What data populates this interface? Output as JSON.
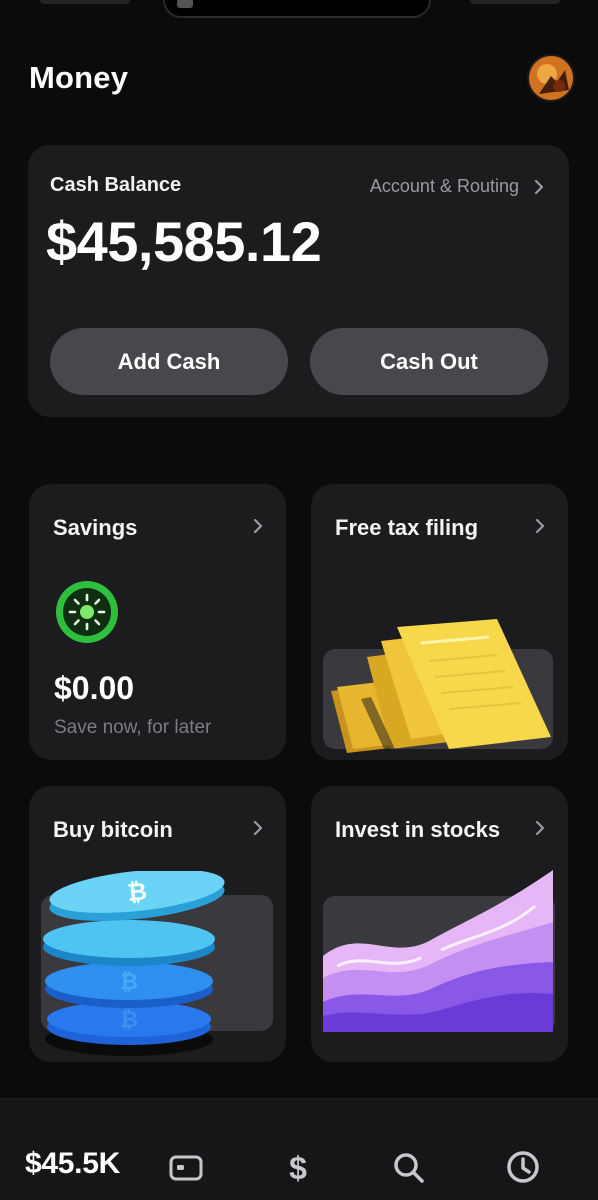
{
  "header": {
    "title": "Money"
  },
  "balance_card": {
    "label": "Cash Balance",
    "account_link": "Account & Routing",
    "amount": "$45,585.12",
    "add_cash_label": "Add Cash",
    "cash_out_label": "Cash Out"
  },
  "tiles": [
    {
      "title": "Savings",
      "amount": "$0.00",
      "subtitle": "Save now, for later",
      "icon": "savings-sun-icon"
    },
    {
      "title": "Free tax filing",
      "icon": "tax-documents-illustration"
    },
    {
      "title": "Buy bitcoin",
      "icon": "bitcoin-coins-illustration"
    },
    {
      "title": "Invest in stocks",
      "icon": "stocks-waves-illustration"
    }
  ],
  "bottom_nav": {
    "balance": "$45.5K",
    "items": [
      "card-icon",
      "dollar-icon",
      "search-icon",
      "clock-icon"
    ]
  },
  "colors": {
    "background": "#0b0b0c",
    "card": "#1c1c1e",
    "button": "#48484c",
    "muted_text": "#9a9aa0",
    "savings_green": "#2fbf3f",
    "tax_yellow": "#f6d84a",
    "bitcoin_blue": "#2aa8e8",
    "stocks_purple": "#9b6cf0"
  }
}
